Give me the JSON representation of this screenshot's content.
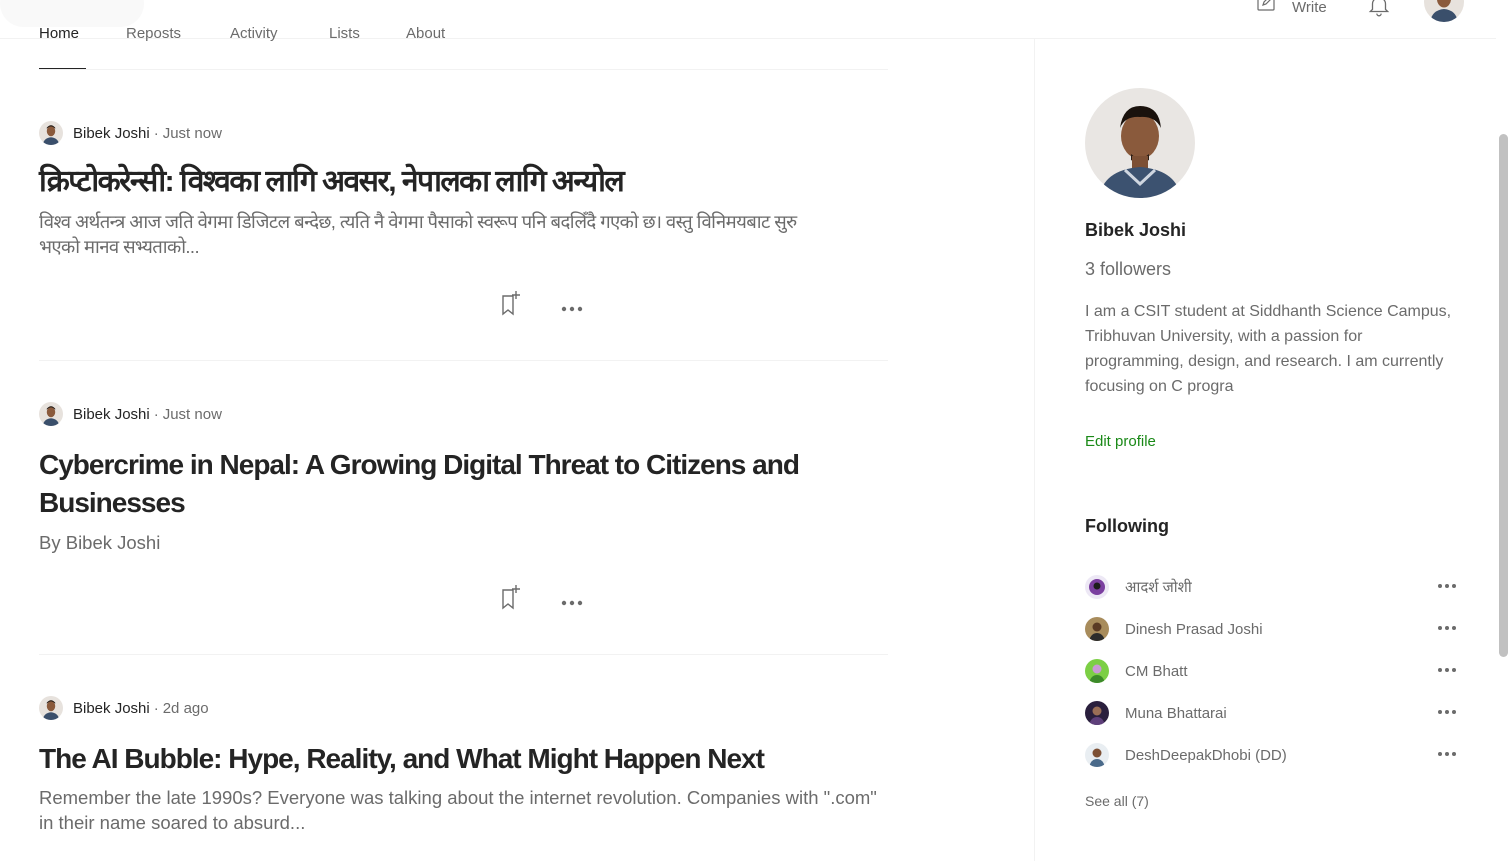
{
  "header": {
    "write_label": "Write"
  },
  "tabs": [
    {
      "label": "Home"
    },
    {
      "label": "Reposts"
    },
    {
      "label": "Activity"
    },
    {
      "label": "Lists"
    },
    {
      "label": "About"
    }
  ],
  "articles": [
    {
      "author": "Bibek Joshi",
      "separator": "·",
      "time": "Just now",
      "title": "क्रिप्टोकरेन्सी: विश्वका लागि अवसर, नेपालका लागि अन्योल",
      "subtitle": "विश्व अर्थतन्त्र आज जति वेगमा डिजिटल बन्देछ, त्यति नै वेगमा पैसाको स्वरूप पनि बदलिँदै गएको छ। वस्तु विनिमयबाट सुरु भएको मानव सभ्यताको..."
    },
    {
      "author": "Bibek Joshi",
      "separator": "·",
      "time": "Just now",
      "title": "Cybercrime in Nepal: A Growing Digital Threat to Citizens and Businesses",
      "subtitle": "By Bibek Joshi"
    },
    {
      "author": "Bibek Joshi",
      "separator": "·",
      "time": "2d ago",
      "title": "The AI Bubble: Hype, Reality, and What Might Happen Next",
      "subtitle": "Remember the late 1990s? Everyone was talking about the internet revolution. Companies with \".com\" in their name soared to absurd..."
    }
  ],
  "sidebar": {
    "name": "Bibek Joshi",
    "followers": "3 followers",
    "bio": "I am a CSIT student at Siddhanth Science Campus, Tribhuvan University, with a passion for programming, design, and research. I am currently focusing on C progra",
    "edit_profile": "Edit profile",
    "following_title": "Following",
    "following": [
      {
        "name": "आदर्श जोशी",
        "color": "#7b3fa0"
      },
      {
        "name": "Dinesh Prasad Joshi",
        "color": "#8a6a3a"
      },
      {
        "name": "CM Bhatt",
        "color": "#6fbf3a"
      },
      {
        "name": "Muna Bhattarai",
        "color": "#3a2a5a"
      },
      {
        "name": "DeshDeepakDhobi (DD)",
        "color": "#4a6a8a"
      }
    ],
    "see_all": "See all (7)"
  },
  "colors": {
    "accent_green": "#1a8917",
    "text": "#242424",
    "muted": "#6b6b6b"
  }
}
